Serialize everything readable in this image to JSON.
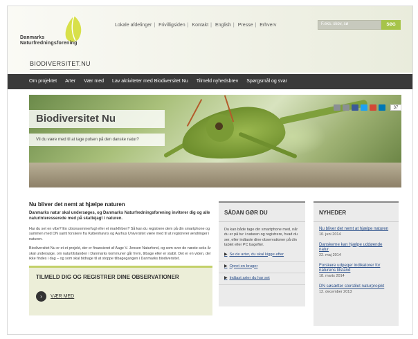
{
  "header": {
    "logo_line1": "Danmarks",
    "logo_line2": "Naturfredningsforening",
    "toplinks": [
      "Lokale afdelinger",
      "Frivilligsiden",
      "Kontakt",
      "English",
      "Presse",
      "Erhverv"
    ],
    "search_placeholder": "F.eks. skov, sø",
    "search_button": "SØG",
    "site_name": "BIODIVERSITET.NU"
  },
  "nav": {
    "items": [
      "Om projektet",
      "Arter",
      "Vær med",
      "Lav aktiviteter med Biodiversitet Nu",
      "Tilmeld nyhedsbrev",
      "Spørgsmål og svar"
    ]
  },
  "hero": {
    "title": "Biodiversitet Nu",
    "subtitle": "Vil du være med til at tage pulsen på den danske natur?",
    "share_count": "37"
  },
  "colors": {
    "brand_yellow": "#d8e04a",
    "accent_green": "#a6c449",
    "nav_bg": "#3a3a3a",
    "link": "#2a4f8a"
  },
  "main": {
    "heading": "Nu bliver det nemt at hjælpe naturen",
    "lead": "Danmarks natur skal undersøges, og Danmarks Naturfredningsforening inviterer dig og alle naturinteresserede med på skattejagt i naturen.",
    "para1": "Har du set en vibe? En citronsommerfugl eller et markfirben? Så kan du registrere dem på din smartphone og sammen med DN samt forskere fra Københavns og Aarhus Universitet være med til at registrerer ændringer i naturen.",
    "para2": "Biodiversitet Nu er et et projekt, der er finansieret af Aage V. Jensen Naturfond, og som over de næste seks år skal undersøge, om naturtilstanden i Danmarks kommuner går frem, tilbage eller er stabil. Det er en viden, der ikke findes i dag – og som skal bidrage til at stoppe tilbagegangen i Danmarks biodiversitet.",
    "signup_title": "TILMELD DIG OG REGISTRER DINE OBSERVATIONER",
    "signup_cta": "VÆR MED"
  },
  "howto": {
    "title": "SÅDAN GØR DU",
    "body": "Du kan både tage din smartphone med, når du er på tur i naturen og registrere, hvad du ser, eller indtaste dine observationer på din tablet eller PC bagefter.",
    "links": [
      "Se de arter, du skal kigge efter",
      "Opret en bruger",
      "Indtast arter du har set"
    ]
  },
  "news": {
    "title": "NYHEDER",
    "items": [
      {
        "title": "Nu bliver det nemt at hjælpe naturen",
        "date": "10. juni 2014"
      },
      {
        "title": "Danskerne kan hjælpe uddøende natur",
        "date": "22. maj 2014"
      },
      {
        "title": "Forskere udpeger indikatorer for naturens tilstand",
        "date": "18. marts 2014"
      },
      {
        "title": "DN søsætter storstilet naturprojekt",
        "date": "12. december 2013"
      }
    ]
  }
}
